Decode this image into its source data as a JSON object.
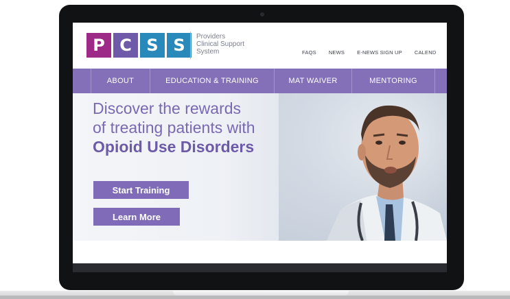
{
  "logo": {
    "letters": [
      "P",
      "C",
      "S",
      "S"
    ],
    "colors": [
      "#9c2a86",
      "#6f5aa9",
      "#2a89bb",
      "#2a89bb"
    ],
    "subtitle_lines": [
      "Providers",
      "Clinical Support",
      "System"
    ]
  },
  "topnav": [
    "FAQS",
    "NEWS",
    "E-NEWS SIGN UP",
    "CALEND"
  ],
  "mainnav": [
    "ABOUT",
    "EDUCATION & TRAINING",
    "MAT WAIVER",
    "MENTORING"
  ],
  "hero": {
    "line1": "Discover the rewards",
    "line2": "of treating patients with",
    "line3": "Opioid Use Disorders",
    "start_button": "Start Training",
    "learn_button": "Learn More"
  },
  "colors": {
    "brand_purple": "#8470b8",
    "button_purple": "#7f6bb7"
  }
}
